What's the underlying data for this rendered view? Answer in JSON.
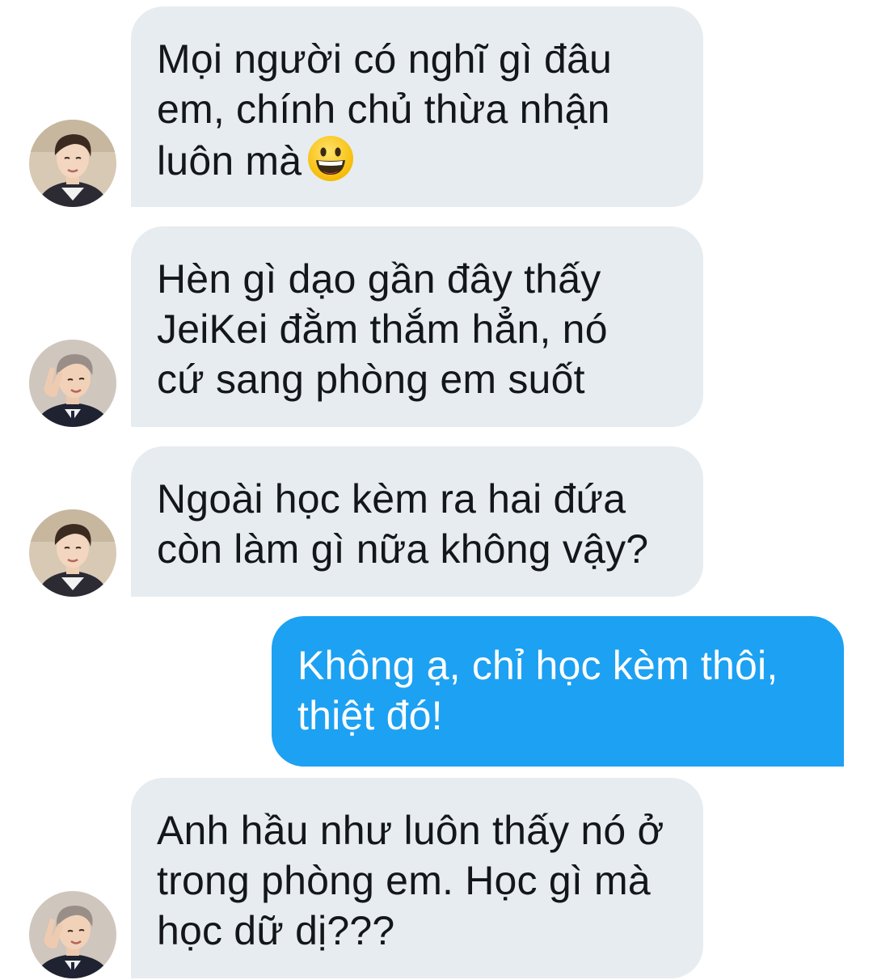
{
  "messages": [
    {
      "side": "incoming",
      "avatar_icon": "avatar-person-1",
      "text": "Mọi người có nghĩ gì đâu\nem, chính chủ thừa nhận\nluôn mà",
      "emoji_icon": "grinning-face-icon"
    },
    {
      "side": "incoming",
      "avatar_icon": "avatar-person-2",
      "text": "Hèn gì dạo gần đây thấy\nJeiKei đằm thắm hẳn, nó\ncứ sang phòng em suốt"
    },
    {
      "side": "incoming",
      "avatar_icon": "avatar-person-1",
      "text": "Ngoài học kèm ra hai đứa\ncòn làm gì nữa không vậy?"
    },
    {
      "side": "outgoing",
      "text": "Không ạ, chỉ học kèm thôi,\nthiệt đó!"
    },
    {
      "side": "incoming",
      "avatar_icon": "avatar-person-2",
      "text": "Anh hầu như luôn thấy nó ở\ntrong phòng em. Học gì mà\nhọc dữ dị???"
    }
  ],
  "colors": {
    "incoming_bubble": "#e6ecf0",
    "incoming_text": "#14171a",
    "outgoing_bubble": "#1da1f2",
    "outgoing_text": "#ffffff",
    "background": "#ffffff"
  }
}
